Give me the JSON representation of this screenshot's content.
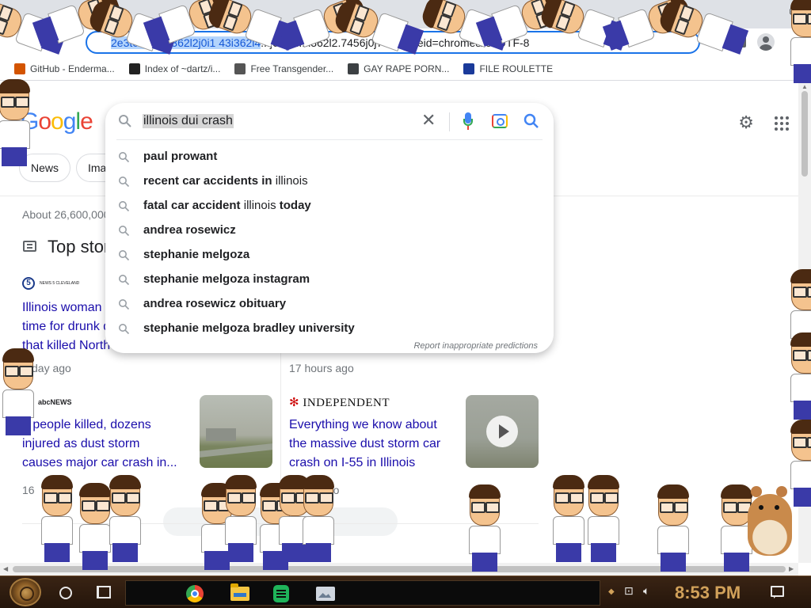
{
  "browser": {
    "url_selected": "2e3t0f0u0l4i362l2j0i1 43i362i4",
    "url_rest": "...j0i0l0....i362l2.7456j0j7&sourceid=chrome&ie=UTF-8",
    "window_controls": {
      "restore": "⧉"
    }
  },
  "bookmarks": [
    {
      "label": "GitHub - Enderma...",
      "icon": "github-icon",
      "color": "#d35400"
    },
    {
      "label": "Index of ~dartz/i...",
      "icon": "folder-icon",
      "color": "#222222"
    },
    {
      "label": "Free Transgender...",
      "icon": "mask-icon",
      "color": "#555555"
    },
    {
      "label": "GAY RAPE PORN...",
      "icon": "globe-icon",
      "color": "#3c4043"
    },
    {
      "label": "FILE ROULETTE",
      "icon": "mf-icon",
      "color": "#1a3a9a"
    }
  ],
  "google": {
    "logo_letters": [
      {
        "ch": "G",
        "color": "#4285f4"
      },
      {
        "ch": "o",
        "color": "#ea4335"
      },
      {
        "ch": "o",
        "color": "#fbbc05"
      },
      {
        "ch": "g",
        "color": "#4285f4"
      },
      {
        "ch": "l",
        "color": "#34a853"
      },
      {
        "ch": "e",
        "color": "#ea4335"
      }
    ],
    "chips": [
      "News",
      "Ima"
    ],
    "result_count": "About 26,600,000",
    "top_stories_title": "Top stor"
  },
  "search": {
    "query": "illinois dui crash",
    "suggestions": [
      [
        {
          "t": "paul prowant",
          "b": true
        }
      ],
      [
        {
          "t": "recent car accidents in",
          "b": true
        },
        {
          "t": " illinois",
          "b": false
        }
      ],
      [
        {
          "t": "fatal car accident",
          "b": true
        },
        {
          "t": " illinois ",
          "b": false
        },
        {
          "t": "today",
          "b": true
        }
      ],
      [
        {
          "t": "andrea rosewicz",
          "b": true
        }
      ],
      [
        {
          "t": "stephanie melgoza",
          "b": true
        }
      ],
      [
        {
          "t": "stephanie melgoza instagram",
          "b": true
        }
      ],
      [
        {
          "t": "andrea rosewicz obituary",
          "b": true
        }
      ],
      [
        {
          "t": "stephanie melgoza bradley university",
          "b": true
        }
      ]
    ],
    "report_text": "Report inappropriate predictions"
  },
  "stories": {
    "s1": {
      "source": "NEWS 5 CLEVELAND",
      "title_lines": [
        "Illinois woman",
        "time for drunk d",
        "that killed North"
      ],
      "time": "day ago"
    },
    "s2": {
      "time": "17 hours ago"
    },
    "s3": {
      "source": "abcNEWS",
      "title_lines": [
        "7 people killed, dozens",
        "injured as dust storm",
        "causes major car crash in..."
      ],
      "time": "16"
    },
    "s4": {
      "source": "INDEPENDENT",
      "title_lines": [
        "Everything we know about",
        "the massive dust storm car",
        "crash on I-55 in Illinois"
      ],
      "time": "ago"
    },
    "more_label": "Mo"
  },
  "taskbar": {
    "apps": [
      "chrome-icon",
      "file-explorer-icon",
      "sheets-icon",
      "photos-icon"
    ],
    "clock": "8:53 PM"
  }
}
